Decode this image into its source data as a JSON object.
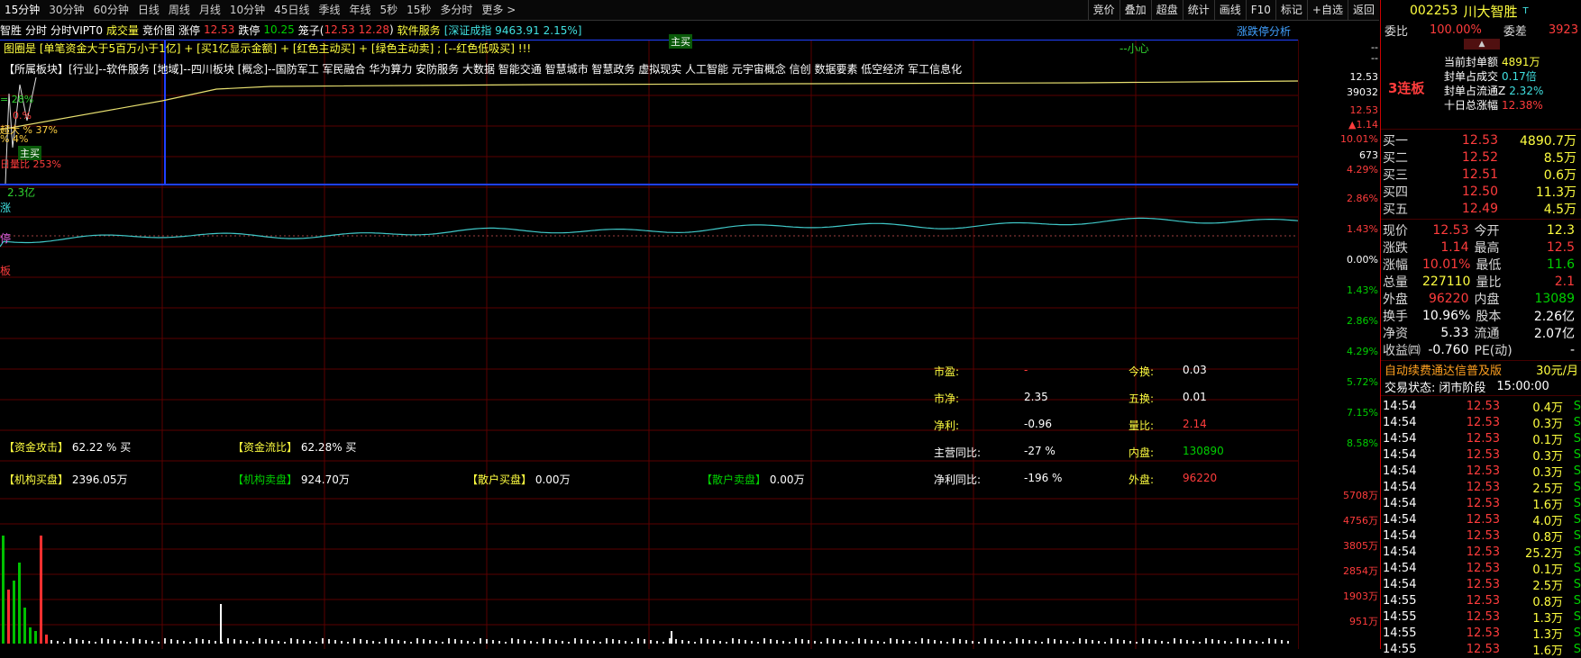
{
  "toolbar": {
    "timeframes": [
      "15分钟",
      "30分钟",
      "60分钟",
      "日线",
      "周线",
      "月线",
      "10分钟",
      "45日线",
      "季线",
      "年线",
      "5秒",
      "15秒",
      "多分时",
      "更多 >"
    ],
    "right_buttons": [
      "竞价",
      "叠加",
      "超盘",
      "统计",
      "画线",
      "F10",
      "标记",
      "+自选",
      "返回"
    ]
  },
  "infoline": {
    "prefix": "智胜",
    "tabs": [
      "分时",
      "分时VIPT0"
    ],
    "volume_label": "成交量",
    "auction_label": "竞价图",
    "limit_up_label": "涨停",
    "limit_up_value": "12.53",
    "limit_down_label": "跌停",
    "limit_down_value": "10.25",
    "cage_label": "笼子(",
    "cage_values": "12.53 12.28",
    "cage_close": ")",
    "sector": "软件服务",
    "index_text": "[深证成指 9463.91 2.15%]"
  },
  "chart": {
    "signals_line": "[单笔资金大于5百万小于1亿] + [买1亿显示金额] + [红色主动买] + [绿色主动卖] ; [--红色低吸买] !!!",
    "signal_prefix": "图圈是",
    "tag_zhumai": "主买",
    "tag_xiaoxin": "--小心",
    "limit_analysis": "涨跌停分析",
    "sector_line": "【所属板块】[行业]--软件服务 [地域]--四川板块 [概念]--国防军工 军民融合 华为算力 安防服务 大数据 智能交通 智慧城市 智慧政务 虚拟现实 人工智能 元宇宙概念 信创 数据要素 低空经济 军工信息化",
    "left_labels": [
      "= 28%",
      "0.%",
      "超大 % 37%",
      "% 4%",
      "主买",
      "日量比 253%"
    ],
    "amount_label": "2.3亿",
    "side_labels": [
      "涨",
      "停",
      "板"
    ],
    "zj_attack_label": "【资金攻击】",
    "zj_attack_value": "62.22 % 买",
    "zj_flow_label": "【资金流比】",
    "zj_flow_value": "62.28% 买",
    "inst_buy_label": "【机构买盘】",
    "inst_buy_value": "2396.05万",
    "inst_sell_label": "【机构卖盘】",
    "inst_sell_value": "924.70万",
    "retail_buy_label": "【散户买盘】",
    "retail_buy_value": "0.00万",
    "retail_sell_label": "【散户卖盘】",
    "retail_sell_value": "0.00万",
    "fin": {
      "pe_label": "市盈:",
      "pe_value": "-",
      "pb_label": "市净:",
      "pb_value": "2.35",
      "np_label": "净利:",
      "np_value": "-0.96",
      "mb_label": "主营同比:",
      "mb_value": "-27 %",
      "npy_label": "净利同比:",
      "npy_value": "-196 %",
      "th_label": "今换:",
      "th_value": "0.03",
      "fh_label": "五换:",
      "fh_value": "0.01",
      "vr_label": "量比:",
      "vr_value": "2.14",
      "inner_label": "内盘:",
      "inner_value": "130890",
      "outer_label": "外盘:",
      "outer_value": "96220"
    }
  },
  "axis": {
    "top_labels": [
      "--",
      "--",
      "12.53",
      "39032",
      "12.53",
      "▲1.14",
      "10.01%",
      "673",
      "4.29%",
      "2.86%",
      "1.43%",
      "0.00%",
      "1.43%",
      "2.86%",
      "4.29%",
      "5.72%",
      "7.15%",
      "8.58%"
    ],
    "vol_labels": [
      "5708万",
      "4756万",
      "3805万",
      "2854万",
      "1903万",
      "951万"
    ]
  },
  "panel": {
    "code": "002253",
    "name": "川大智胜",
    "weibi_label": "委比",
    "weibi_value": "100.00%",
    "weicha_label": "委差",
    "weicha_value": "3923",
    "lianban": "3连板",
    "seal_lines": [
      {
        "label": "当前封单额",
        "value": "4891万"
      },
      {
        "label": "封单占成交",
        "value": "0.17倍"
      },
      {
        "label": "封单占流通Z",
        "value": "2.32%"
      },
      {
        "label": "十日总涨幅",
        "value": "12.38%"
      }
    ],
    "bids": [
      {
        "label": "买一",
        "price": "12.53",
        "vol": "4890.7万"
      },
      {
        "label": "买二",
        "price": "12.52",
        "vol": "8.5万"
      },
      {
        "label": "买三",
        "price": "12.51",
        "vol": "0.6万"
      },
      {
        "label": "买四",
        "price": "12.50",
        "vol": "11.3万"
      },
      {
        "label": "买五",
        "price": "12.49",
        "vol": "4.5万"
      }
    ],
    "quote": [
      {
        "l1": "现价",
        "v1": "12.53",
        "l2": "今开",
        "v2": "12.3"
      },
      {
        "l1": "涨跌",
        "v1": "1.14",
        "l2": "最高",
        "v2": "12.5"
      },
      {
        "l1": "涨幅",
        "v1": "10.01%",
        "l2": "最低",
        "v2": "11.6"
      },
      {
        "l1": "总量",
        "v1": "227110",
        "l2": "量比",
        "v2": "2.1"
      },
      {
        "l1": "外盘",
        "v1": "96220",
        "l2": "内盘",
        "v2": "13089"
      },
      {
        "l1": "换手",
        "v1": "10.96%",
        "l2": "股本",
        "v2": "2.26亿"
      },
      {
        "l1": "净资",
        "v1": "5.33",
        "l2": "流通",
        "v2": "2.07亿"
      },
      {
        "l1": "收益㈣",
        "v1": "-0.760",
        "l2": "PE(动)",
        "v2": "-"
      }
    ],
    "ad_text": "自动续费通达信普及版",
    "ad_price": "30元/月",
    "status_label": "交易状态:",
    "status_value": "闭市阶段",
    "status_time": "15:00:00",
    "ticks": [
      {
        "t": "14:54",
        "p": "12.53",
        "v": "0.4万",
        "s": "S"
      },
      {
        "t": "14:54",
        "p": "12.53",
        "v": "0.3万",
        "s": "S"
      },
      {
        "t": "14:54",
        "p": "12.53",
        "v": "0.1万",
        "s": "S"
      },
      {
        "t": "14:54",
        "p": "12.53",
        "v": "0.3万",
        "s": "S"
      },
      {
        "t": "14:54",
        "p": "12.53",
        "v": "0.3万",
        "s": "S"
      },
      {
        "t": "14:54",
        "p": "12.53",
        "v": "2.5万",
        "s": "S"
      },
      {
        "t": "14:54",
        "p": "12.53",
        "v": "1.6万",
        "s": "S"
      },
      {
        "t": "14:54",
        "p": "12.53",
        "v": "4.0万",
        "s": "S"
      },
      {
        "t": "14:54",
        "p": "12.53",
        "v": "0.8万",
        "s": "S"
      },
      {
        "t": "14:54",
        "p": "12.53",
        "v": "25.2万",
        "s": "S"
      },
      {
        "t": "14:54",
        "p": "12.53",
        "v": "0.1万",
        "s": "S"
      },
      {
        "t": "14:54",
        "p": "12.53",
        "v": "2.5万",
        "s": "S"
      },
      {
        "t": "14:55",
        "p": "12.53",
        "v": "0.8万",
        "s": "S"
      },
      {
        "t": "14:55",
        "p": "12.53",
        "v": "1.3万",
        "s": "S"
      },
      {
        "t": "14:55",
        "p": "12.53",
        "v": "1.3万",
        "s": "S"
      },
      {
        "t": "14:55",
        "p": "12.53",
        "v": "1.6万",
        "s": "S"
      }
    ]
  },
  "colors": {
    "accent_red": "#ff3c3c",
    "accent_green": "#00d000",
    "line_yellow": "#e8e070",
    "line_cyan": "#40c8c8",
    "grid_red": "#5a0000"
  }
}
